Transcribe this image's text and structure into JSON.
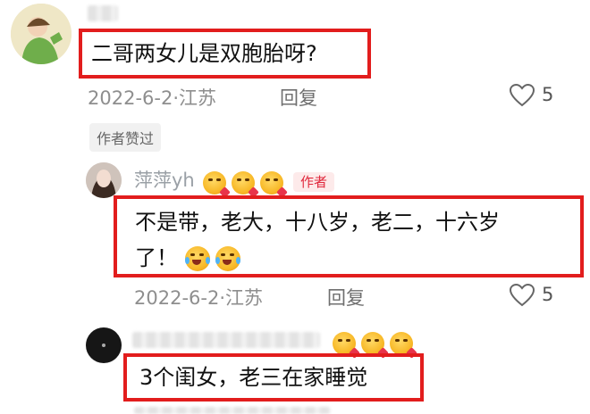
{
  "comments": [
    {
      "text": "二哥两女儿是双胞胎呀?",
      "date": "2022-6-2",
      "location": "江苏",
      "reply_label": "回复",
      "likes": "5",
      "tag": "作者赞过"
    },
    {
      "author": "萍萍yh",
      "author_badge": "作者",
      "text_line1": "不是带，老大，十八岁，老二，十六岁",
      "text_line2": "了！",
      "date": "2022-6-2",
      "location": "江苏",
      "reply_label": "回复",
      "likes": "5"
    },
    {
      "text": "3个闺女，老三在家睡觉"
    }
  ],
  "colors": {
    "highlight": "#e21d1d",
    "author_badge": "#e0283c"
  },
  "icons": [
    "kiss-emoji-icon",
    "laughing-tears-emoji-icon",
    "heart-outline-icon"
  ]
}
